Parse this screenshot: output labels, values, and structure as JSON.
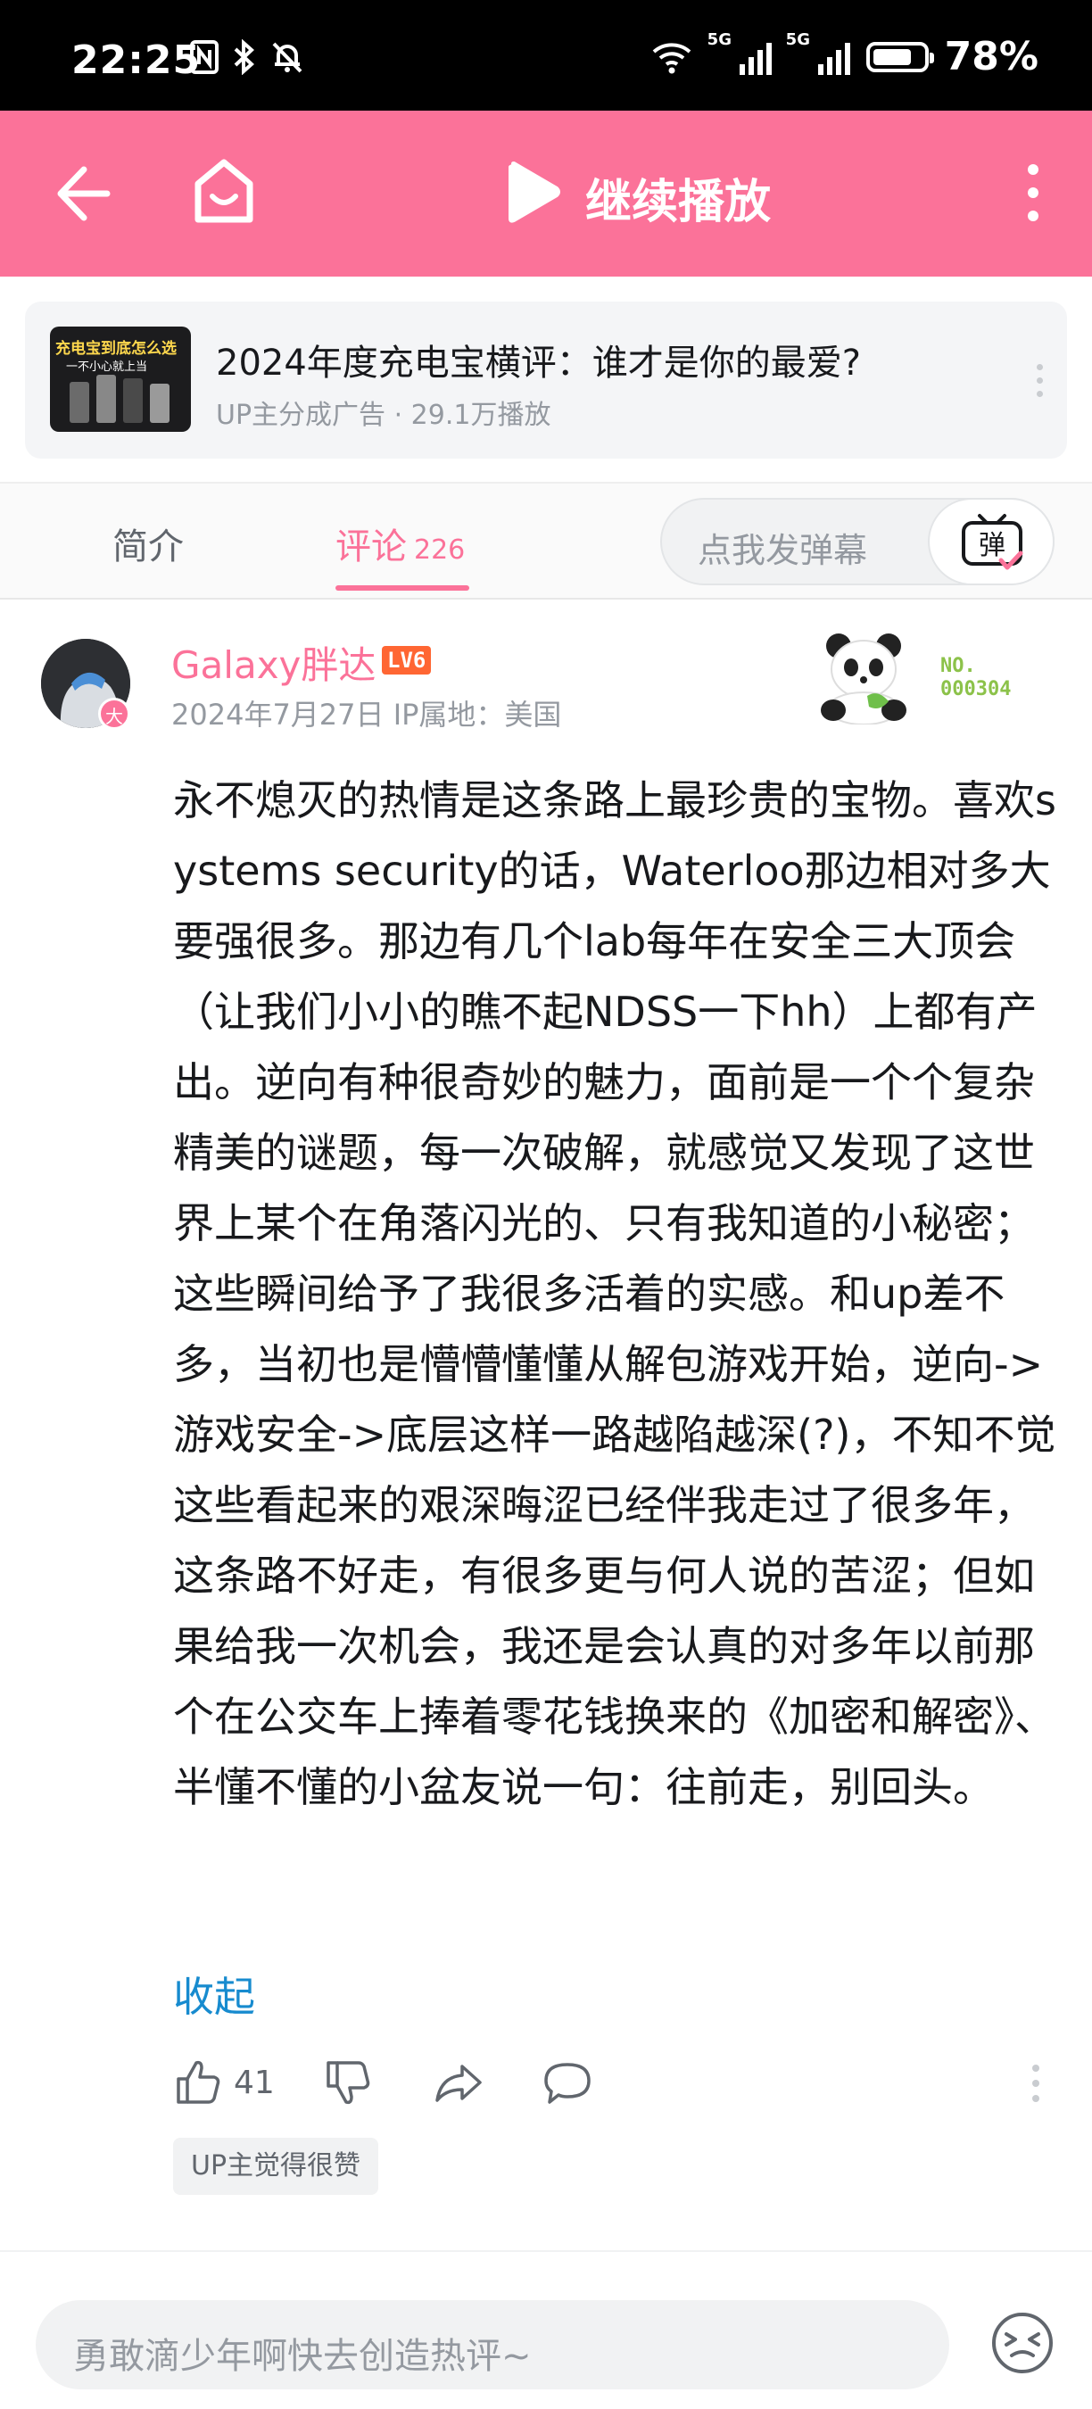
{
  "status_bar": {
    "time": "22:25",
    "battery": "78%",
    "battery_level": 0.78,
    "signal_labels": [
      "5G",
      "5G"
    ]
  },
  "header": {
    "title": "继续播放"
  },
  "ad": {
    "thumb_caption": "充电宝到底怎么选",
    "thumb_subcaption": "一不小心就上当",
    "title": "2024年度充电宝横评：谁才是你的最爱?",
    "subtitle": "UP主分成广告 · 29.1万播放"
  },
  "tabs": {
    "intro": "简介",
    "comments": "评论",
    "comments_count": "226",
    "danmaku_placeholder": "点我发弹幕",
    "danmaku_button": "弹"
  },
  "comment": {
    "avatar_badge": "大",
    "username": "Galaxy胖达",
    "level": "LV6",
    "meta": "2024年7月27日 IP属地：美国",
    "fan_label": "NO.",
    "fan_number": "000304",
    "content": "永不熄灭的热情是这条路上最珍贵的宝物。喜欢systems security的话，Waterloo那边相对多大要强很多。那边有几个lab每年在安全三大顶会（让我们小小的瞧不起NDSS一下hh）上都有产出。逆向有种很奇妙的魅力，面前是一个个复杂精美的谜题，每一次破解，就感觉又发现了这世界上某个在角落闪光的、只有我知道的小秘密；这些瞬间给予了我很多活着的实感。和up差不多，当初也是懵懵懂懂从解包游戏开始，逆向->游戏安全->底层这样一路越陷越深(?)，不知不觉这些看起来的艰深晦涩已经伴我走过了很多年，这条路不好走，有很多更与何人说的苦涩；但如果给我一次机会，我还是会认真的对多年以前那个在公交车上捧着零花钱换来的《加密和解密》、半懂不懂的小盆友说一句：往前走，别回头。",
    "collapse": "收起",
    "likes": "41",
    "up_tag": "UP主觉得很赞"
  },
  "bottom": {
    "input_placeholder": "勇敢滴少年啊快去创造热评~"
  },
  "colors": {
    "brand_pink": "#fb7299",
    "link_blue": "#178bcf",
    "text_gray": "#9499a0"
  }
}
